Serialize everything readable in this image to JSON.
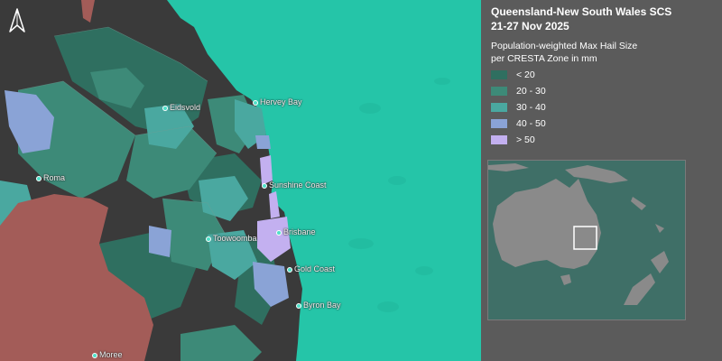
{
  "map": {
    "cities": [
      {
        "name": "Eidsvold"
      },
      {
        "name": "Hervey Bay"
      },
      {
        "name": "Roma"
      },
      {
        "name": "Sunshine Coast"
      },
      {
        "name": "Brisbane"
      },
      {
        "name": "Toowoomba"
      },
      {
        "name": "Gold Coast"
      },
      {
        "name": "Byron Bay"
      },
      {
        "name": "Moree"
      }
    ]
  },
  "panel": {
    "title_line1": "Queensland-New South Wales SCS",
    "title_line2": "21-27 Nov 2025",
    "legend_title_line1": "Population-weighted Max Hail Size",
    "legend_title_line2": "per CRESTA Zone in mm",
    "legend": [
      {
        "label": "< 20",
        "color": "#2f6f60"
      },
      {
        "label": "20 - 30",
        "color": "#3d8a78"
      },
      {
        "label": "30 - 40",
        "color": "#4aa8a0"
      },
      {
        "label": "40 - 50",
        "color": "#8aa3d6"
      },
      {
        "label": "> 50",
        "color": "#c3b0f0"
      }
    ]
  },
  "colors": {
    "ocean": "#25c7aa",
    "land_dark": "#3a3a3a",
    "outside_zone": "#a35c58"
  }
}
